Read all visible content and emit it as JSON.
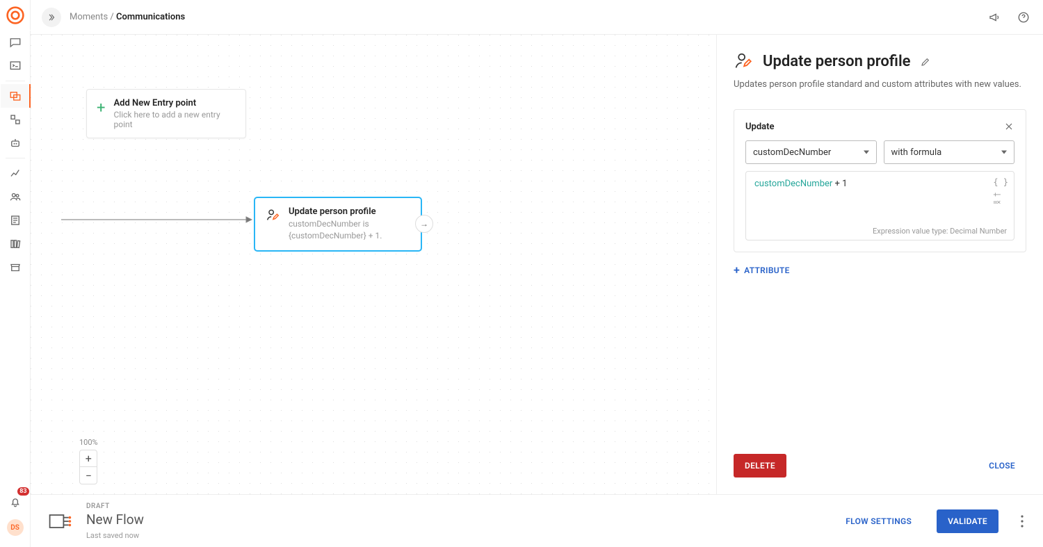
{
  "topbar": {
    "breadcrumb_root": "Moments",
    "breadcrumb_sep": " / ",
    "breadcrumb_current": "Communications"
  },
  "rail": {
    "notif_count": "83",
    "avatar": "DS"
  },
  "canvas": {
    "entry": {
      "title": "Add New Entry point",
      "subtitle": "Click here to add a new entry point"
    },
    "node": {
      "title": "Update person profile",
      "line1": "customDecNumber is",
      "line2": "{customDecNumber} + 1."
    },
    "zoom": "100%"
  },
  "panel": {
    "title": "Update person profile",
    "desc": "Updates person profile standard and custom attributes with new values.",
    "update_label": "Update",
    "select_attr": "customDecNumber",
    "select_mode": "with formula",
    "expr_token": "customDecNumber",
    "expr_op": " + 1",
    "expr_hint": "Expression value type: Decimal Number",
    "add_attr": "ATTRIBUTE",
    "delete": "DELETE",
    "close": "CLOSE"
  },
  "footer": {
    "status": "DRAFT",
    "name": "New Flow",
    "saved": "Last saved now",
    "settings": "FLOW SETTINGS",
    "validate": "VALIDATE"
  }
}
